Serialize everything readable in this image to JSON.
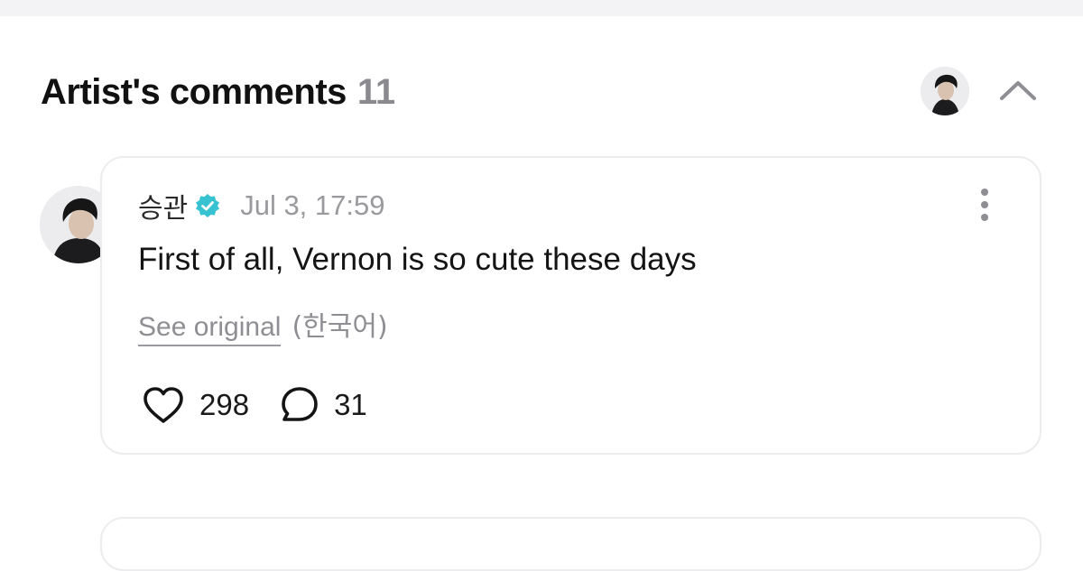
{
  "section": {
    "title": "Artist's comments",
    "count": "11"
  },
  "comment": {
    "author": "승관",
    "timestamp": "Jul 3, 17:59",
    "text": "First of all, Vernon is so cute these days",
    "see_original_label": "See original",
    "original_language": "(한국어)",
    "likes": "298",
    "replies": "31"
  },
  "icons": {
    "collapse": "chevron-up-icon",
    "verified": "verified-badge-icon",
    "more": "more-vertical-icon",
    "like": "heart-icon",
    "reply": "comment-bubble-icon"
  },
  "colors": {
    "verified": "#36c2d0",
    "muted": "#8e8e93",
    "card_border": "#ececef"
  }
}
